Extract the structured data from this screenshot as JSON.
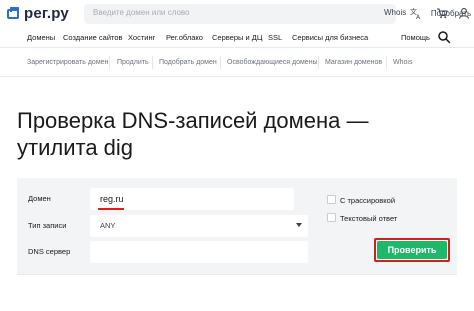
{
  "header": {
    "logo_text": "рег.ру",
    "search": {
      "placeholder": "Введите домен или слово",
      "whois_label": "Whois",
      "button_label": "Подобрать"
    }
  },
  "main_nav": {
    "items": [
      "Домены",
      "Создание сайтов",
      "Хостинг",
      "Рег.облако",
      "Серверы и ДЦ",
      "SSL",
      "Сервисы для бизнеса"
    ],
    "help_label": "Помощь"
  },
  "sub_nav": {
    "items": [
      "Зарегистрировать домен",
      "Продлить",
      "Подобрать домен",
      "Освобождающиеся домены",
      "Магазин доменов",
      "Whois"
    ]
  },
  "page": {
    "title_line1": "Проверка DNS-записей домена —",
    "title_line2": "утилита dig"
  },
  "form": {
    "domain_label": "Домен",
    "domain_value": "reg.ru",
    "record_type_label": "Тип записи",
    "record_type_value": "ANY",
    "dns_server_label": "DNS сервер",
    "dns_server_value": "",
    "trace_label": "С трассировкой",
    "trace_checked": false,
    "text_answer_label": "Текстовый ответ",
    "text_answer_checked": false,
    "submit_label": "Проверить"
  },
  "colors": {
    "brand_blue": "#2b6fd6",
    "submit_green": "#1fb86b",
    "highlight_red": "#d02020"
  }
}
